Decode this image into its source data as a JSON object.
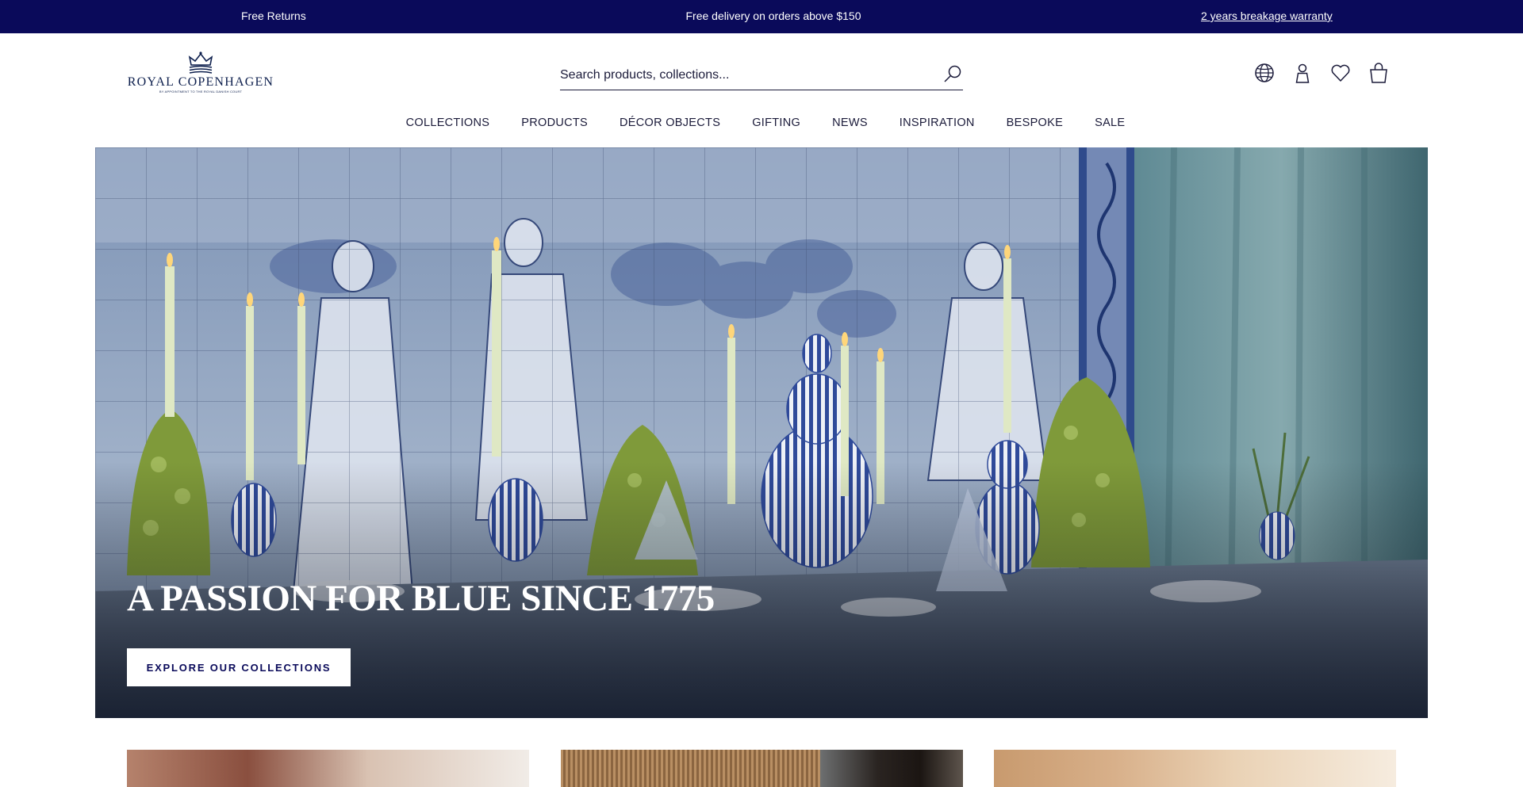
{
  "topbar": {
    "left": "Free Returns",
    "center": "Free delivery on orders above $150",
    "right": "2 years breakage warranty"
  },
  "logo": {
    "name": "ROYAL COPENHAGEN",
    "subtitle": "BY APPOINTMENT TO THE ROYAL DANISH COURT"
  },
  "search": {
    "placeholder": "Search products, collections..."
  },
  "header_icons": [
    "globe-icon",
    "account-icon",
    "heart-icon",
    "bag-icon"
  ],
  "nav": [
    {
      "label": "COLLECTIONS"
    },
    {
      "label": "PRODUCTS"
    },
    {
      "label": "DÉCOR OBJECTS"
    },
    {
      "label": "GIFTING"
    },
    {
      "label": "NEWS"
    },
    {
      "label": "INSPIRATION"
    },
    {
      "label": "BESPOKE"
    },
    {
      "label": "SALE"
    }
  ],
  "hero": {
    "title": "A PASSION FOR BLUE SINCE 1775",
    "button": "EXPLORE OUR COLLECTIONS"
  },
  "colors": {
    "topbar": "#0a0a5a",
    "brand_navy": "#0d1f4d",
    "text": "#1b1b3a"
  }
}
